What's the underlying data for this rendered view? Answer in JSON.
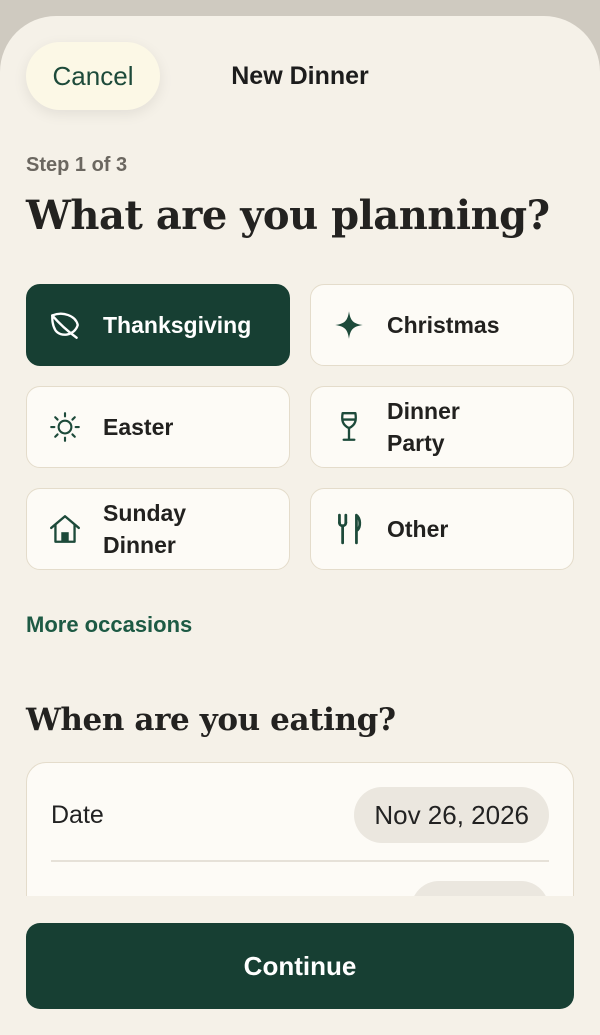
{
  "header": {
    "cancel_label": "Cancel",
    "title": "New Dinner"
  },
  "step_label": "Step 1 of 3",
  "planning": {
    "heading": "What are you planning?",
    "occasions": [
      {
        "label": "Thanksgiving",
        "icon": "leaf-icon",
        "selected": true
      },
      {
        "label": "Christmas",
        "icon": "sparkle-icon",
        "selected": false
      },
      {
        "label": "Easter",
        "icon": "sun-icon",
        "selected": false
      },
      {
        "label": "Dinner Party",
        "icon": "wine-glass-icon",
        "selected": false
      },
      {
        "label": "Sunday Dinner",
        "icon": "house-icon",
        "selected": false
      },
      {
        "label": "Other",
        "icon": "fork-knife-icon",
        "selected": false
      }
    ],
    "more_label": "More occasions"
  },
  "when": {
    "heading": "When are you eating?",
    "date_label": "Date",
    "date_value": "Nov 26, 2026"
  },
  "footer": {
    "continue_label": "Continue"
  },
  "colors": {
    "accent": "#173f33",
    "background": "#f5f1e8",
    "card": "#fdfbf6",
    "link": "#1d5a44"
  }
}
